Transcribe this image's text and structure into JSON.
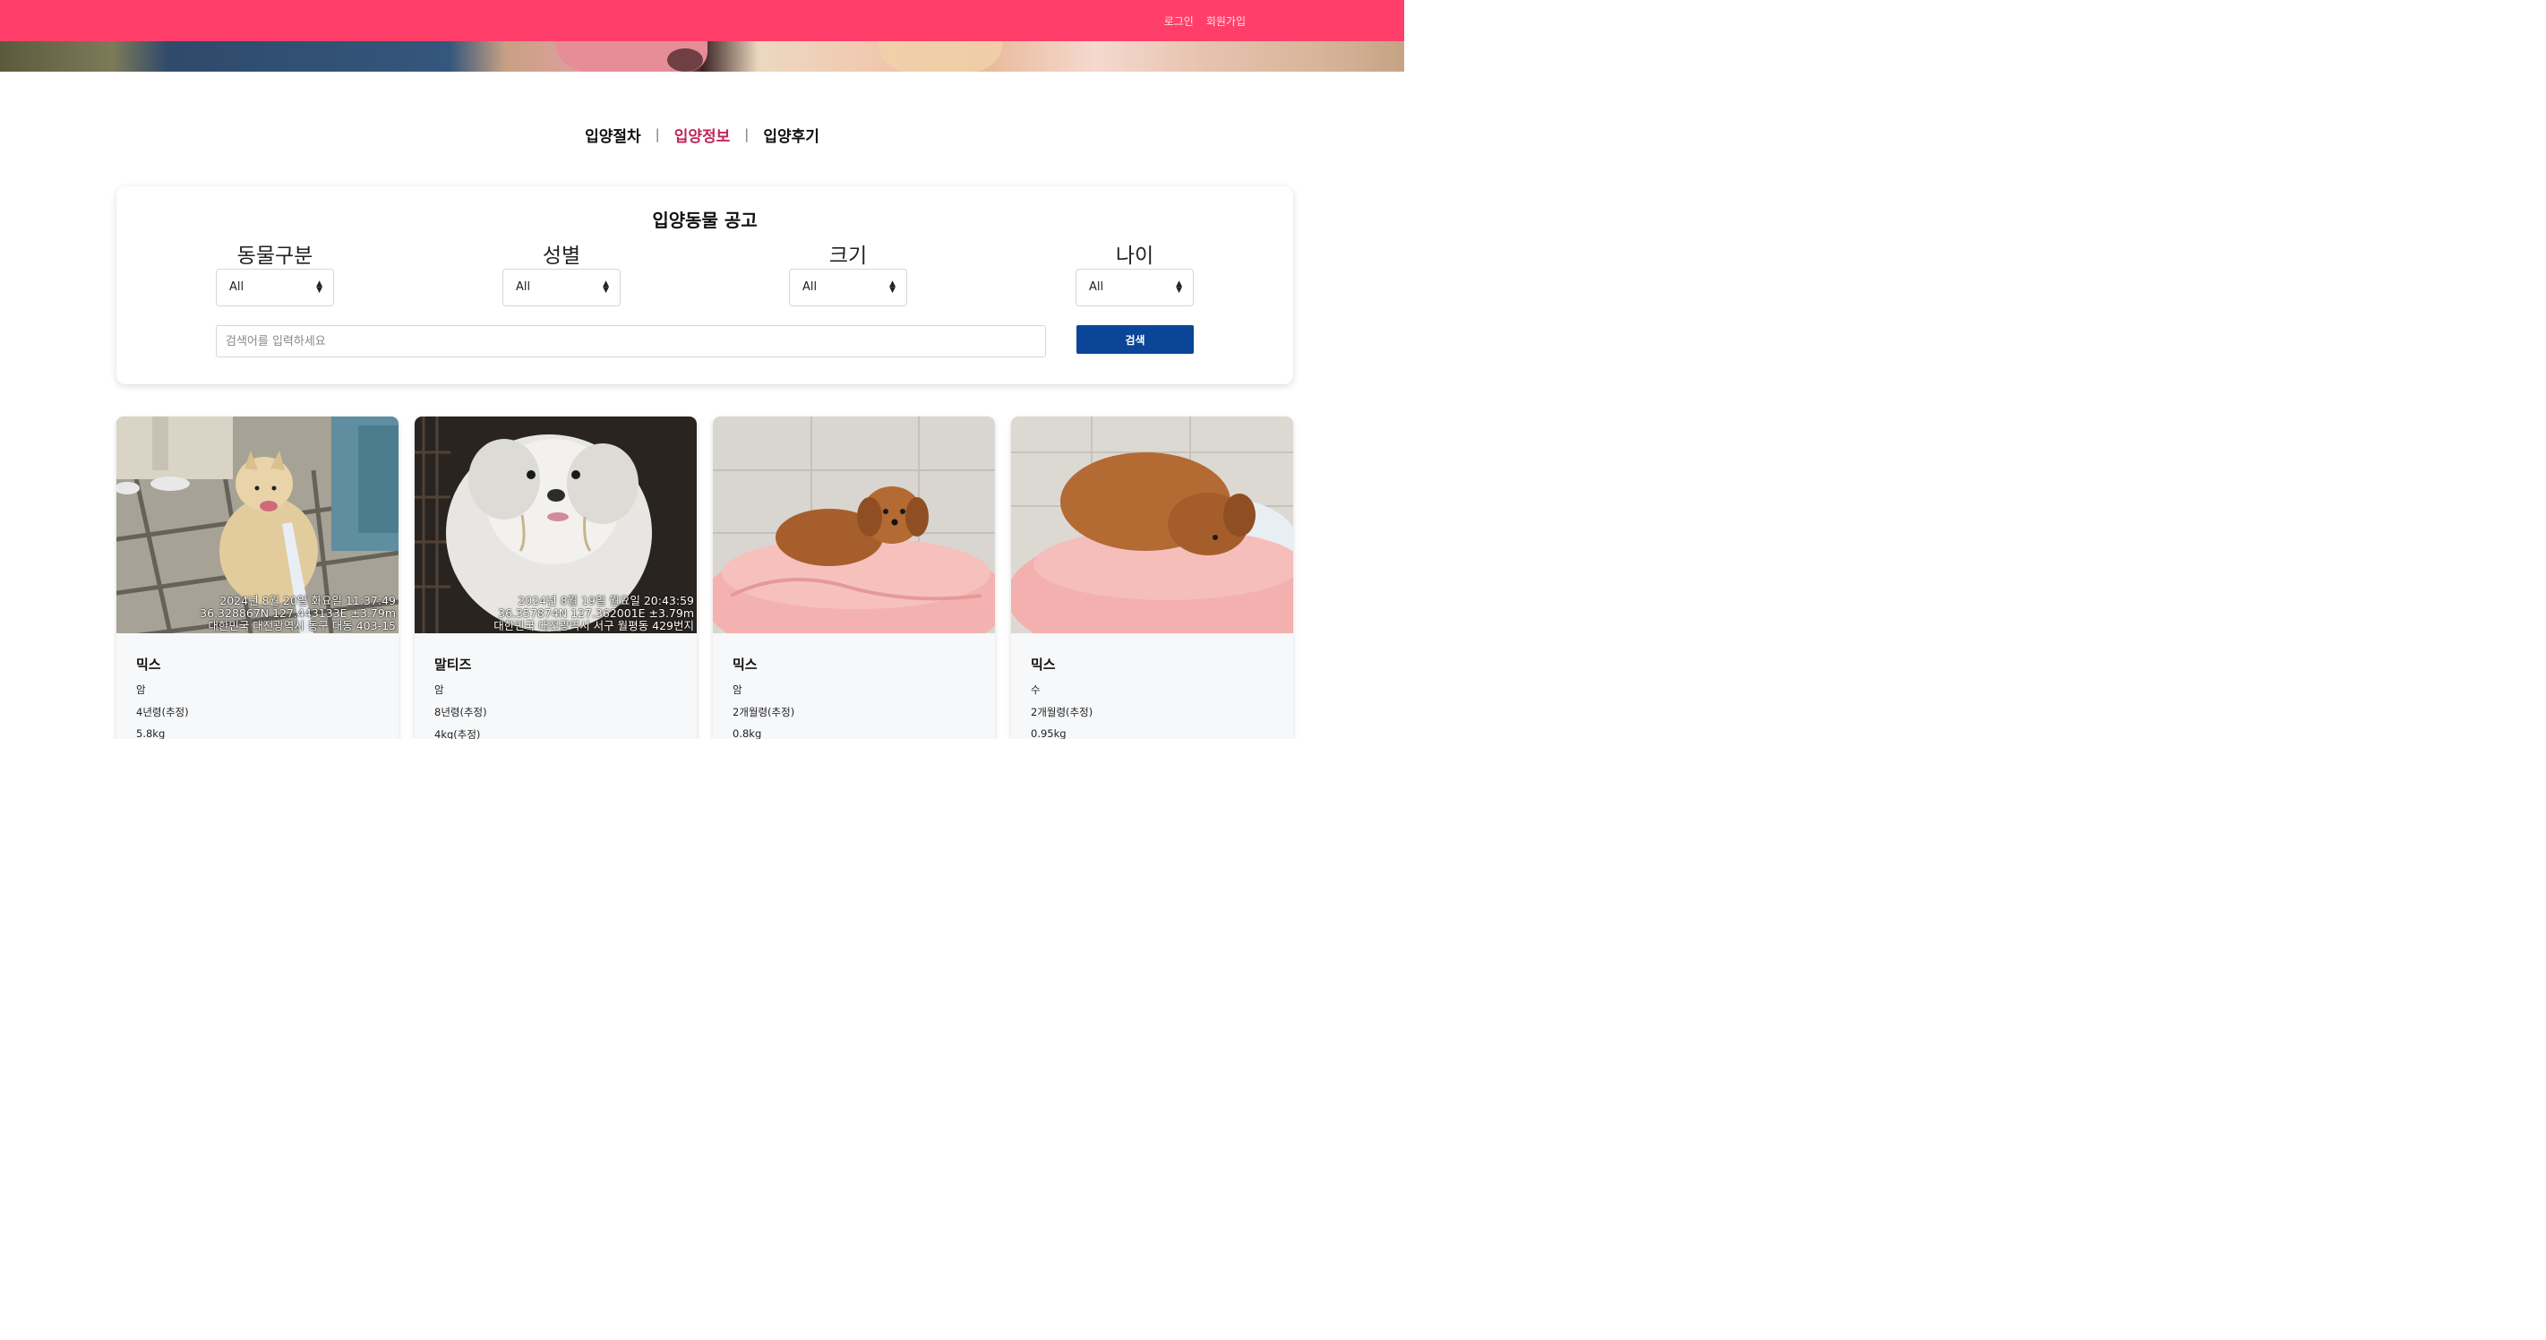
{
  "auth": {
    "login": "로그인",
    "signup": "회원가입"
  },
  "subnav": {
    "items": [
      "입양절차",
      "입양정보",
      "입양후기"
    ],
    "active_index": 1,
    "separator": "|"
  },
  "panel": {
    "title": "입양동물 공고",
    "filters": [
      {
        "label": "동물구분",
        "value": "All"
      },
      {
        "label": "성별",
        "value": "All"
      },
      {
        "label": "크기",
        "value": "All"
      },
      {
        "label": "나이",
        "value": "All"
      }
    ],
    "search_placeholder": "검색어를 입력하세요",
    "search_button": "검색"
  },
  "cards": [
    {
      "breed": "믹스",
      "sex": "암",
      "age": "4년령(추정)",
      "weight": "5.8kg",
      "stamp": [
        "2024년 8월 20일 화요일 11:37:49",
        "36.328867N 127.443133E ±3.79m",
        "대한민국 대전광역시 동구 대동 403-15"
      ],
      "photo": "pomeranian-on-tiled-sidewalk"
    },
    {
      "breed": "말티즈",
      "sex": "암",
      "age": "8년령(추정)",
      "weight": "4kg(추정)",
      "stamp": [
        "2024년 8월 19일 월요일 20:43:59",
        "36.357874N 127.362001E ±3.79m",
        "대한민국 대전광역시 서구 월평동 429번지"
      ],
      "photo": "white-maltese-in-cage"
    },
    {
      "breed": "믹스",
      "sex": "암",
      "age": "2개월령(추정)",
      "weight": "0.8kg",
      "stamp": [],
      "photo": "brown-puppy-on-pink-cushion"
    },
    {
      "breed": "믹스",
      "sex": "수",
      "age": "2개월령(추정)",
      "weight": "0.95kg",
      "stamp": [],
      "photo": "brown-puppy-lying-on-pink-cushion"
    }
  ],
  "colors": {
    "topbar": "#ff3f6a",
    "active_nav": "#c2255c",
    "search_button": "#0b4597"
  }
}
